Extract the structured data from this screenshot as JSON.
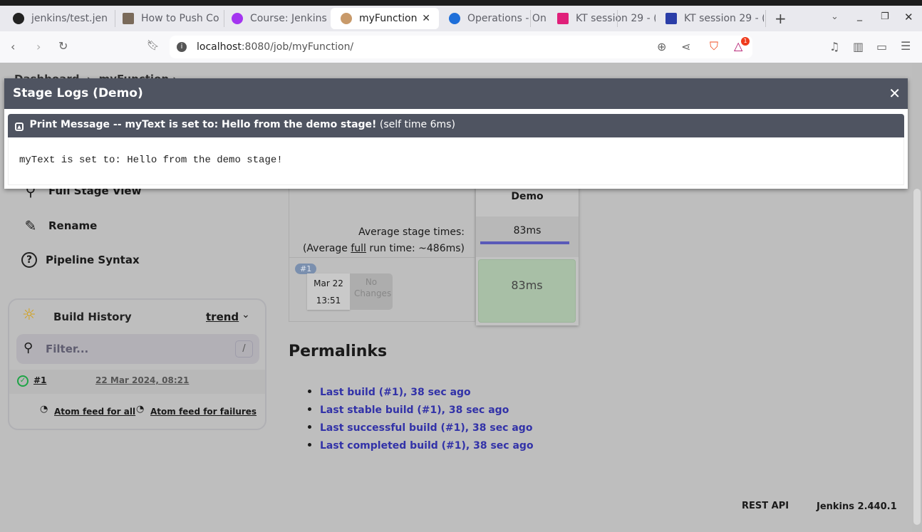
{
  "browser": {
    "tabs": [
      {
        "title": "jenkins/test.jen",
        "color": "#222"
      },
      {
        "title": "How to Push Co",
        "color": "#7a6a5a"
      },
      {
        "title": "Course: Jenkins",
        "color": "#a435f0"
      },
      {
        "title": "myFunction",
        "color": "#c89a6a"
      },
      {
        "title": "Operations - On",
        "color": "#1e6fd9"
      },
      {
        "title": "KT session 29 - (",
        "color": "#e0207a"
      },
      {
        "title": "KT session 29 - (",
        "color": "#2b3ea8"
      }
    ],
    "url_host": "localhost",
    "url_rest": ":8080/job/myFunction/",
    "notification_count": "1"
  },
  "breadcrumb": [
    "Dashboard",
    "myFunction"
  ],
  "sidebar": [
    {
      "label": "Full Stage View",
      "icon": "search-icon"
    },
    {
      "label": "Rename",
      "icon": "pencil-icon"
    },
    {
      "label": "Pipeline Syntax",
      "icon": "help-icon"
    }
  ],
  "build_history": {
    "title": "Build History",
    "trend": "trend",
    "filter_placeholder": "Filter...",
    "shortcut": "/",
    "builds": [
      {
        "number": "#1",
        "date": "22 Mar 2024, 08:21"
      }
    ],
    "feed_all": "Atom feed for all",
    "feed_failures": "Atom feed for failures"
  },
  "stage_view": {
    "stage_name": "Demo",
    "avg_label": "Average stage times:",
    "avg_full_prefix": "(Average ",
    "avg_full_link": "full",
    "avg_full_suffix": " run time: ~486ms)",
    "avg_stage_time": "83ms",
    "run": {
      "badge": "#1",
      "date": "Mar 22",
      "time": "13:51",
      "changes": "No Changes",
      "stage_time": "83ms"
    }
  },
  "permalinks": {
    "title": "Permalinks",
    "links": [
      "Last build (#1), 38 sec ago",
      "Last stable build (#1), 38 sec ago",
      "Last successful build (#1), 38 sec ago",
      "Last completed build (#1), 38 sec ago"
    ]
  },
  "footer": {
    "rest_api": "REST API",
    "version": "Jenkins 2.440.1"
  },
  "modal": {
    "title": "Stage Logs (Demo)",
    "close": "✕",
    "step_title": "Print Message -- myText is set to: Hello from the demo stage!",
    "step_time": "(self time 6ms)",
    "log": "myText is set to: Hello from the demo stage!"
  }
}
